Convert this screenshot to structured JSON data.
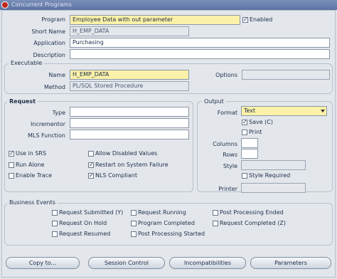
{
  "window": {
    "title": "Concurrent Programs"
  },
  "program": {
    "program_label": "Program",
    "program_value": "Employee Data with out parameter",
    "enabled_label": "Enabled",
    "enabled_checked": true,
    "short_name_label": "Short Name",
    "short_name_value": "H_EMP_DATA",
    "application_label": "Application",
    "application_value": "Purchasing",
    "description_label": "Description",
    "description_value": ""
  },
  "executable": {
    "group_title": "Executable",
    "name_label": "Name",
    "name_value": "H_EMP_DATA",
    "options_label": "Options",
    "options_value": "",
    "method_label": "Method",
    "method_value": "PL/SQL Stored Procedure"
  },
  "request": {
    "group_title": "Request",
    "type_label": "Type",
    "incrementor_label": "Incrementor",
    "mls_label": "MLS Function",
    "checkboxes": [
      {
        "label": "Use in SRS",
        "checked": true
      },
      {
        "label": "Run Alone",
        "checked": false
      },
      {
        "label": "Enable Trace",
        "checked": false
      },
      {
        "label": "Allow Disabled Values",
        "checked": false
      },
      {
        "label": "Restart on System Failure",
        "checked": true
      },
      {
        "label": "NLS Compliant",
        "checked": true
      }
    ]
  },
  "output": {
    "group_title": "Output",
    "format_label": "Format",
    "format_value": "Text",
    "save_label": "Save (C)",
    "save_checked": true,
    "print_label": "Print",
    "print_checked": false,
    "columns_label": "Columns",
    "rows_label": "Rows",
    "style_label": "Style",
    "style_required_label": "Style Required",
    "style_required_checked": false,
    "printer_label": "Printer"
  },
  "business_events": {
    "group_title": "Business Events",
    "items": [
      {
        "label": "Request Submitted (Y)",
        "checked": false
      },
      {
        "label": "Request On Hold",
        "checked": false
      },
      {
        "label": "Request Resumed",
        "checked": false
      },
      {
        "label": "Request Running",
        "checked": false
      },
      {
        "label": "Program Completed",
        "checked": false
      },
      {
        "label": "Post Processing Started",
        "checked": false
      },
      {
        "label": "Post Processing Ended",
        "checked": false
      },
      {
        "label": "Request Completed (Z)",
        "checked": false
      }
    ]
  },
  "buttons": {
    "copy_to": "Copy to...",
    "session_control": "Session Control",
    "incompatibilities": "Incompatibilities",
    "parameters": "Parameters"
  }
}
